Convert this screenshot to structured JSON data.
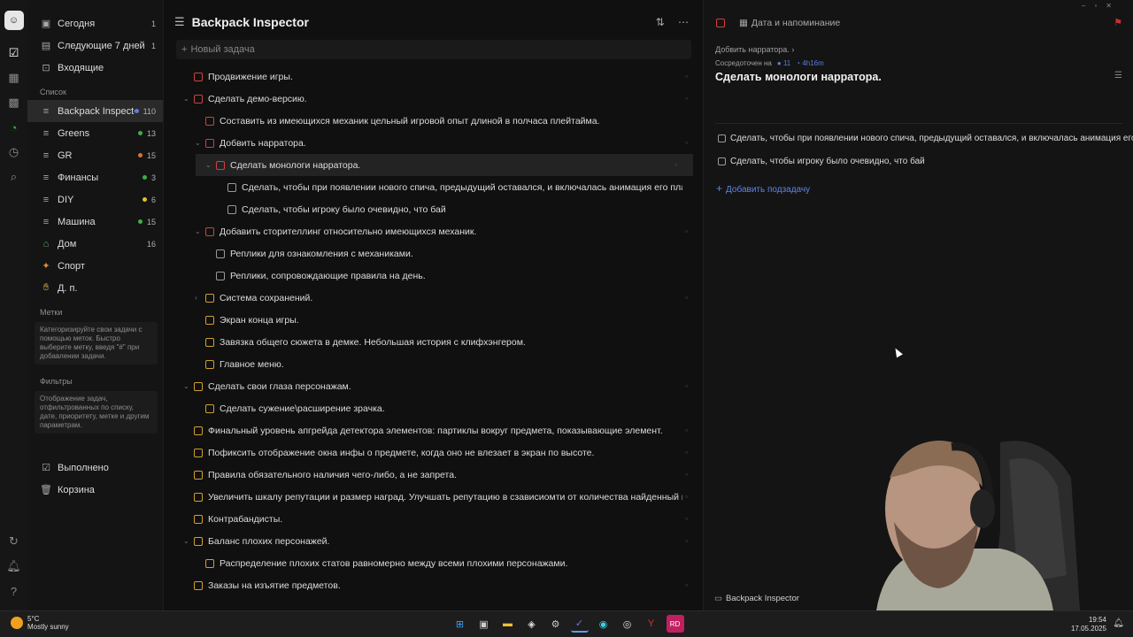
{
  "rail": {
    "icons": [
      "avatar",
      "checkbox-icon",
      "calendar-icon",
      "grid-icon",
      "habit-icon",
      "timer-icon",
      "search-icon",
      "sync-icon",
      "notification-icon",
      "help-icon"
    ]
  },
  "sidebar": {
    "smart": [
      {
        "label": "Сегодня",
        "count": "1"
      },
      {
        "label": "Следующие 7 дней",
        "count": "1"
      },
      {
        "label": "Входящие",
        "count": ""
      }
    ],
    "lists_header": "Список",
    "lists": [
      {
        "label": "Backpack Inspector",
        "count": "110",
        "color": "#5a7ee0"
      },
      {
        "label": "Greens",
        "count": "13",
        "color": "#3cb043"
      },
      {
        "label": "GR",
        "count": "15",
        "color": "#e07030"
      },
      {
        "label": "Финансы",
        "count": "3",
        "color": "#3cb043"
      },
      {
        "label": "DIY",
        "count": "6",
        "color": "#e0c030"
      },
      {
        "label": "Машина",
        "count": "15",
        "color": "#3cb043"
      },
      {
        "label": "Дом",
        "count": "16",
        "color": ""
      },
      {
        "label": "Спорт",
        "count": "",
        "color": ""
      },
      {
        "label": "Д. п.",
        "count": "",
        "color": ""
      }
    ],
    "tags_header": "Метки",
    "tags_hint": "Категоризируйте свои задачи с помощью меток. Быстро выберите метку, введя \"#\" при добавлении задачи.",
    "filters_header": "Фильтры",
    "filters_hint": "Отображение задач, отфильтрованных по списку, дате, приоритету, метке и другим параметрам.",
    "done": "Выполнено",
    "trash": "Корзина"
  },
  "main": {
    "title": "Backpack Inspector",
    "add_placeholder": "Новый задача",
    "tasks": [
      {
        "text": "Продвижение игры.",
        "level": 0,
        "color": "red",
        "arrow": ""
      },
      {
        "text": "Сделать демо-версию.",
        "level": 0,
        "color": "red",
        "arrow": "⌄"
      },
      {
        "text": "Составить из имеющихся механик цельный игровой опыт длиной в полчаса плейтайма.",
        "level": 1,
        "color": "red",
        "arrow": ""
      },
      {
        "text": "Добвить нарратора.",
        "level": 1,
        "color": "red",
        "arrow": "⌄"
      },
      {
        "text": "Сделать монологи нарратора.",
        "level": 2,
        "color": "red",
        "arrow": "⌄",
        "selected": true
      },
      {
        "text": "Сделать, чтобы при появлении нового спича, предыдущий оставался, и включалась анимация его плавного исчезнов",
        "level": 3,
        "color": "gray",
        "arrow": ""
      },
      {
        "text": "Сделать, чтобы игроку было очевидно, что бай",
        "level": 3,
        "color": "gray",
        "arrow": ""
      },
      {
        "text": "Добавить сторителлинг относительно имеющихся механик.",
        "level": 1,
        "color": "red",
        "arrow": "⌄"
      },
      {
        "text": "Реплики для ознакомления с механиками.",
        "level": 2,
        "color": "gray",
        "arrow": ""
      },
      {
        "text": "Реплики, сопровождающие правила на день.",
        "level": 2,
        "color": "gray",
        "arrow": ""
      },
      {
        "text": "Система сохранений.",
        "level": 1,
        "color": "yellow",
        "arrow": "›"
      },
      {
        "text": "Экран конца игры.",
        "level": 1,
        "color": "yellow",
        "arrow": ""
      },
      {
        "text": "Завязка общего сюжета в демке. Небольшая история с клифхэнгером.",
        "level": 1,
        "color": "yellow",
        "arrow": ""
      },
      {
        "text": "Главное меню.",
        "level": 1,
        "color": "yellow",
        "arrow": ""
      },
      {
        "text": "Сделать свои глаза персонажам.",
        "level": 0,
        "color": "yellow",
        "arrow": "⌄"
      },
      {
        "text": "Сделать сужение\\расширение зрачка.",
        "level": 1,
        "color": "yellow",
        "arrow": ""
      },
      {
        "text": "Финальный уровень апгрейда детектора элементов: партиклы вокруг предмета, показывающие элемент.",
        "level": 0,
        "color": "yellow",
        "arrow": ""
      },
      {
        "text": "Пофиксить отображение окна инфы о предмете, когда оно не влезает в экран по высоте.",
        "level": 0,
        "color": "yellow",
        "arrow": ""
      },
      {
        "text": "Правила обязательного наличия чего-либо, а не запрета.",
        "level": 0,
        "color": "yellow",
        "arrow": ""
      },
      {
        "text": "Увеличить шкалу репутации и размер наград. Улучшать репутацию в сзависиомти от количества найденный нарушений.",
        "level": 0,
        "color": "yellow",
        "arrow": ""
      },
      {
        "text": "Контрабандисты.",
        "level": 0,
        "color": "yellow",
        "arrow": ""
      },
      {
        "text": "Баланс плохих персонажей.",
        "level": 0,
        "color": "yellow",
        "arrow": "⌄"
      },
      {
        "text": "Распределение плохих статов равномерно между всеми плохими персонажами.",
        "level": 1,
        "color": "yellow",
        "arrow": ""
      },
      {
        "text": "Заказы на изъятие предметов.",
        "level": 0,
        "color": "yellow",
        "arrow": ""
      }
    ]
  },
  "detail": {
    "date_label": "Дата и напоминание",
    "breadcrumb": "Добвить нарратора.",
    "focus_label": "Сосредоточен на",
    "focus_count": "11",
    "focus_time": "4h16m",
    "title": "Сделать монологи нарратора.",
    "subtasks": [
      "Сделать, чтобы при появлении нового спича, предыдущий оставался, и включалась анимация его",
      "Сделать, чтобы игроку было очевидно, что бай"
    ],
    "add_subtask": "Добавить подзадачу",
    "footer_list": "Backpack Inspector"
  },
  "taskbar": {
    "temp": "5°C",
    "weather": "Mostly sunny",
    "time": "19:54",
    "date": "17.05.2025",
    "apps": [
      "windows-start-icon",
      "taskview-icon",
      "file-explorer-icon",
      "unity-icon",
      "settings-icon",
      "ticktick-icon",
      "browser-icon",
      "chrome-icon",
      "yandex-icon",
      "rider-icon"
    ]
  }
}
